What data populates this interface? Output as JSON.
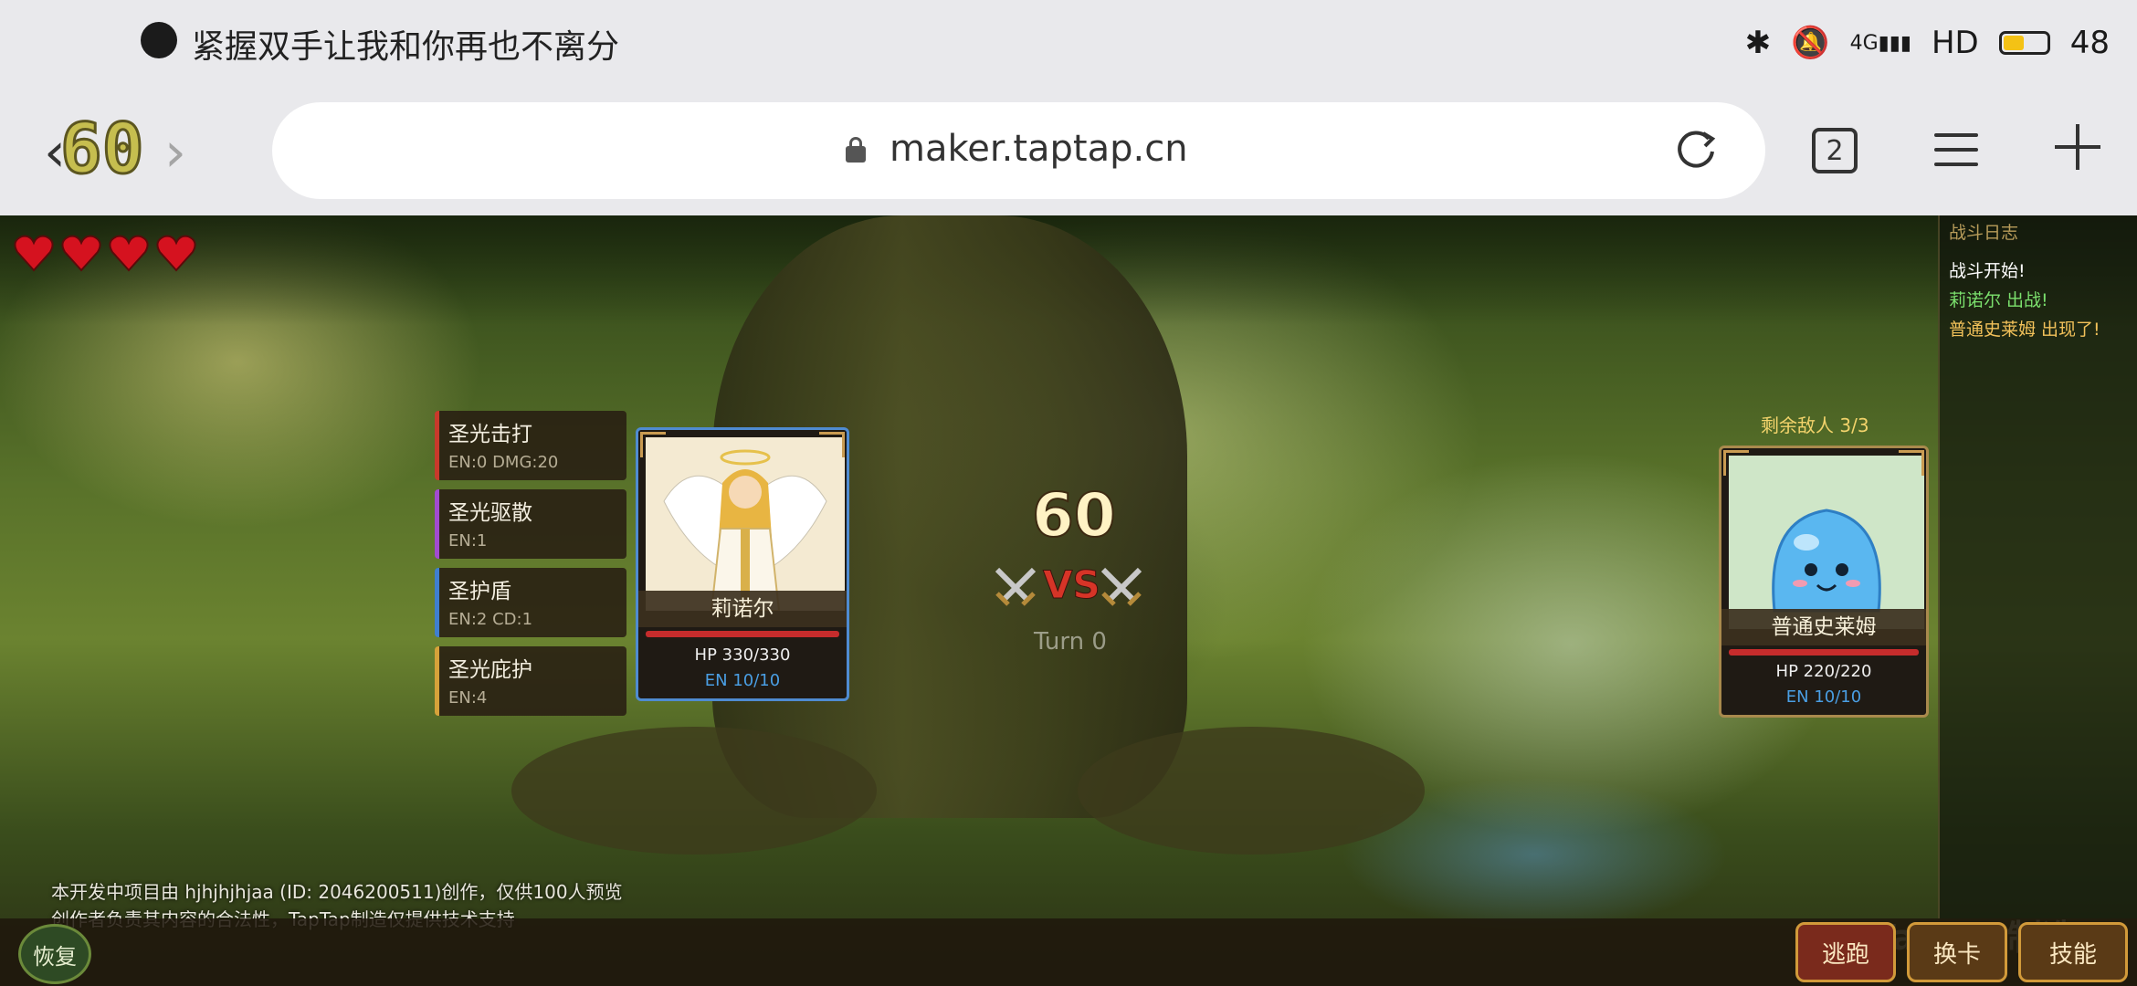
{
  "status_bar": {
    "notification_title": "紧握双手让我和你再也不离分",
    "network": "HD",
    "signal_label": "4G",
    "battery_level": "48"
  },
  "browser": {
    "back_glyph": "‹",
    "forward_glyph": "›",
    "url": "maker.taptap.cn",
    "tab_count": "2",
    "fps_overlay": "60"
  },
  "game": {
    "hearts_count": 4,
    "skills": [
      {
        "name": "圣光击打",
        "meta": "EN:0  DMG:20",
        "color": "#c8392b"
      },
      {
        "name": "圣光驱散",
        "meta": "EN:1",
        "color": "#a24bd0"
      },
      {
        "name": "圣护盾",
        "meta": "EN:2  CD:1",
        "color": "#3f7fd0"
      },
      {
        "name": "圣光庇护",
        "meta": "EN:4",
        "color": "#d6a23a"
      }
    ],
    "hero": {
      "name": "莉诺尔",
      "hp": "HP 330/330",
      "en": "EN 10/10",
      "hp_fraction": 1.0
    },
    "enemy": {
      "name": "普通史莱姆",
      "hp": "HP 220/220",
      "en": "EN 10/10",
      "count_label": "剩余敌人 3/3",
      "hp_fraction": 1.0
    },
    "timer": "60",
    "vs": "VS",
    "turn": "Turn 0",
    "log": {
      "title": "战斗日志",
      "lines": [
        {
          "text": "战斗开始!",
          "color": "#ffffff"
        },
        {
          "text": "莉诺尔 出战!",
          "color": "#7be06d"
        },
        {
          "text": "普通史莱姆 出现了!",
          "color": "#f2c15a"
        }
      ]
    },
    "disclaimer": {
      "line1": "本开发中项目由 hjhjhjhjaa (ID: 2046200511)创作，仅供100人预览",
      "line2": "创作者负责其内容的合法性，TapTap制造仅提供技术支持"
    },
    "buttons": {
      "restore": "恢复",
      "escape": "逃跑",
      "swap": "换卡",
      "skill": "技能"
    },
    "watermark": "TapTap制造"
  },
  "icons": {
    "heart": "heart-icon",
    "lock": "lock-icon",
    "reload": "reload-icon",
    "menu": "menu-icon",
    "add": "add-tab-icon",
    "swords": "crossed-swords-icon"
  },
  "colors": {
    "accent_gold": "#d29a3a",
    "hero_border": "#4f8bd1",
    "hp_red": "#c62c2c",
    "en_blue": "#4a9ee3"
  }
}
